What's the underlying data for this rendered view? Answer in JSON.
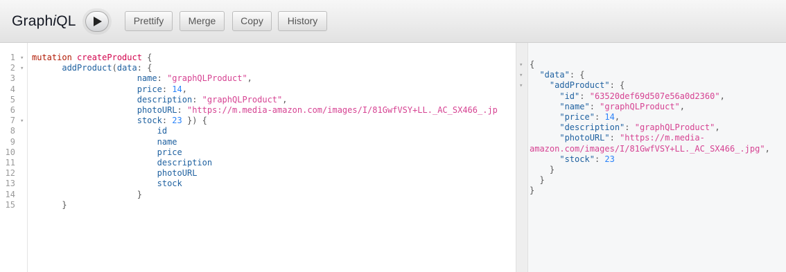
{
  "app": {
    "title_prefix": "Graph",
    "title_italic": "i",
    "title_suffix": "QL"
  },
  "toolbar": {
    "run_label": "",
    "buttons": [
      {
        "label": "Prettify"
      },
      {
        "label": "Merge"
      },
      {
        "label": "Copy"
      },
      {
        "label": "History"
      }
    ]
  },
  "query_editor": {
    "line_numbers": [
      "1",
      "2",
      "3",
      "4",
      "5",
      "6",
      "7",
      "8",
      "9",
      "10",
      "11",
      "12",
      "13",
      "14",
      "15"
    ],
    "lines": [
      [
        {
          "t": "kw",
          "s": "mutation"
        },
        {
          "t": "p",
          "s": " "
        },
        {
          "t": "def",
          "s": "createProduct"
        },
        {
          "t": "punc",
          "s": " {"
        }
      ],
      [
        {
          "t": "p",
          "s": "      "
        },
        {
          "t": "prop",
          "s": "addProduct"
        },
        {
          "t": "punc",
          "s": "("
        },
        {
          "t": "prop",
          "s": "data"
        },
        {
          "t": "punc",
          "s": ": {"
        }
      ],
      [
        {
          "t": "p",
          "s": "                     "
        },
        {
          "t": "prop",
          "s": "name"
        },
        {
          "t": "punc",
          "s": ": "
        },
        {
          "t": "str",
          "s": "\"graphQLProduct\""
        },
        {
          "t": "punc",
          "s": ","
        }
      ],
      [
        {
          "t": "p",
          "s": "                     "
        },
        {
          "t": "prop",
          "s": "price"
        },
        {
          "t": "punc",
          "s": ": "
        },
        {
          "t": "num",
          "s": "14"
        },
        {
          "t": "punc",
          "s": ","
        }
      ],
      [
        {
          "t": "p",
          "s": "                     "
        },
        {
          "t": "prop",
          "s": "description"
        },
        {
          "t": "punc",
          "s": ": "
        },
        {
          "t": "str",
          "s": "\"graphQLProduct\""
        },
        {
          "t": "punc",
          "s": ","
        }
      ],
      [
        {
          "t": "p",
          "s": "                     "
        },
        {
          "t": "prop",
          "s": "photoURL"
        },
        {
          "t": "punc",
          "s": ": "
        },
        {
          "t": "str",
          "s": "\"https://m.media-amazon.com/images/I/81GwfVSY+LL._AC_SX466_.jp"
        }
      ],
      [
        {
          "t": "p",
          "s": "                     "
        },
        {
          "t": "prop",
          "s": "stock"
        },
        {
          "t": "punc",
          "s": ": "
        },
        {
          "t": "num",
          "s": "23"
        },
        {
          "t": "punc",
          "s": " }) {"
        }
      ],
      [
        {
          "t": "p",
          "s": "                         "
        },
        {
          "t": "prop",
          "s": "id"
        }
      ],
      [
        {
          "t": "p",
          "s": "                         "
        },
        {
          "t": "prop",
          "s": "name"
        }
      ],
      [
        {
          "t": "p",
          "s": "                         "
        },
        {
          "t": "prop",
          "s": "price"
        }
      ],
      [
        {
          "t": "p",
          "s": "                         "
        },
        {
          "t": "prop",
          "s": "description"
        }
      ],
      [
        {
          "t": "p",
          "s": "                         "
        },
        {
          "t": "prop",
          "s": "photoURL"
        }
      ],
      [
        {
          "t": "p",
          "s": "                         "
        },
        {
          "t": "prop",
          "s": "stock"
        }
      ],
      [
        {
          "t": "p",
          "s": "                     "
        },
        {
          "t": "punc",
          "s": "}"
        }
      ],
      [
        {
          "t": "p",
          "s": "      "
        },
        {
          "t": "punc",
          "s": "}"
        }
      ]
    ]
  },
  "result_viewer": {
    "lines": [
      [
        {
          "t": "punc",
          "s": "{"
        }
      ],
      [
        {
          "t": "p",
          "s": "  "
        },
        {
          "t": "key",
          "s": "\"data\""
        },
        {
          "t": "punc",
          "s": ": {"
        }
      ],
      [
        {
          "t": "p",
          "s": "    "
        },
        {
          "t": "key",
          "s": "\"addProduct\""
        },
        {
          "t": "punc",
          "s": ": {"
        }
      ],
      [
        {
          "t": "p",
          "s": "      "
        },
        {
          "t": "key",
          "s": "\"id\""
        },
        {
          "t": "punc",
          "s": ": "
        },
        {
          "t": "str",
          "s": "\"63520def69d507e56a0d2360\""
        },
        {
          "t": "punc",
          "s": ","
        }
      ],
      [
        {
          "t": "p",
          "s": "      "
        },
        {
          "t": "key",
          "s": "\"name\""
        },
        {
          "t": "punc",
          "s": ": "
        },
        {
          "t": "str",
          "s": "\"graphQLProduct\""
        },
        {
          "t": "punc",
          "s": ","
        }
      ],
      [
        {
          "t": "p",
          "s": "      "
        },
        {
          "t": "key",
          "s": "\"price\""
        },
        {
          "t": "punc",
          "s": ": "
        },
        {
          "t": "num",
          "s": "14"
        },
        {
          "t": "punc",
          "s": ","
        }
      ],
      [
        {
          "t": "p",
          "s": "      "
        },
        {
          "t": "key",
          "s": "\"description\""
        },
        {
          "t": "punc",
          "s": ": "
        },
        {
          "t": "str",
          "s": "\"graphQLProduct\""
        },
        {
          "t": "punc",
          "s": ","
        }
      ],
      [
        {
          "t": "p",
          "s": "      "
        },
        {
          "t": "key",
          "s": "\"photoURL\""
        },
        {
          "t": "punc",
          "s": ": "
        },
        {
          "t": "str",
          "s": "\"https://m.media-"
        }
      ],
      [
        {
          "t": "str",
          "s": "amazon.com/images/I/81GwfVSY+LL._AC_SX466_.jpg\""
        },
        {
          "t": "punc",
          "s": ","
        }
      ],
      [
        {
          "t": "p",
          "s": "      "
        },
        {
          "t": "key",
          "s": "\"stock\""
        },
        {
          "t": "punc",
          "s": ": "
        },
        {
          "t": "num",
          "s": "23"
        }
      ],
      [
        {
          "t": "p",
          "s": "    "
        },
        {
          "t": "punc",
          "s": "}"
        }
      ],
      [
        {
          "t": "p",
          "s": "  "
        },
        {
          "t": "punc",
          "s": "}"
        }
      ],
      [
        {
          "t": "punc",
          "s": "}"
        }
      ]
    ]
  },
  "icons": {
    "run": "play-icon",
    "fold": "fold-arrow-icon"
  },
  "colors": {
    "keyword": "#b11a04",
    "definition": "#d2054e",
    "property": "#1f61a0",
    "string": "#d64292",
    "number": "#2882f9"
  }
}
